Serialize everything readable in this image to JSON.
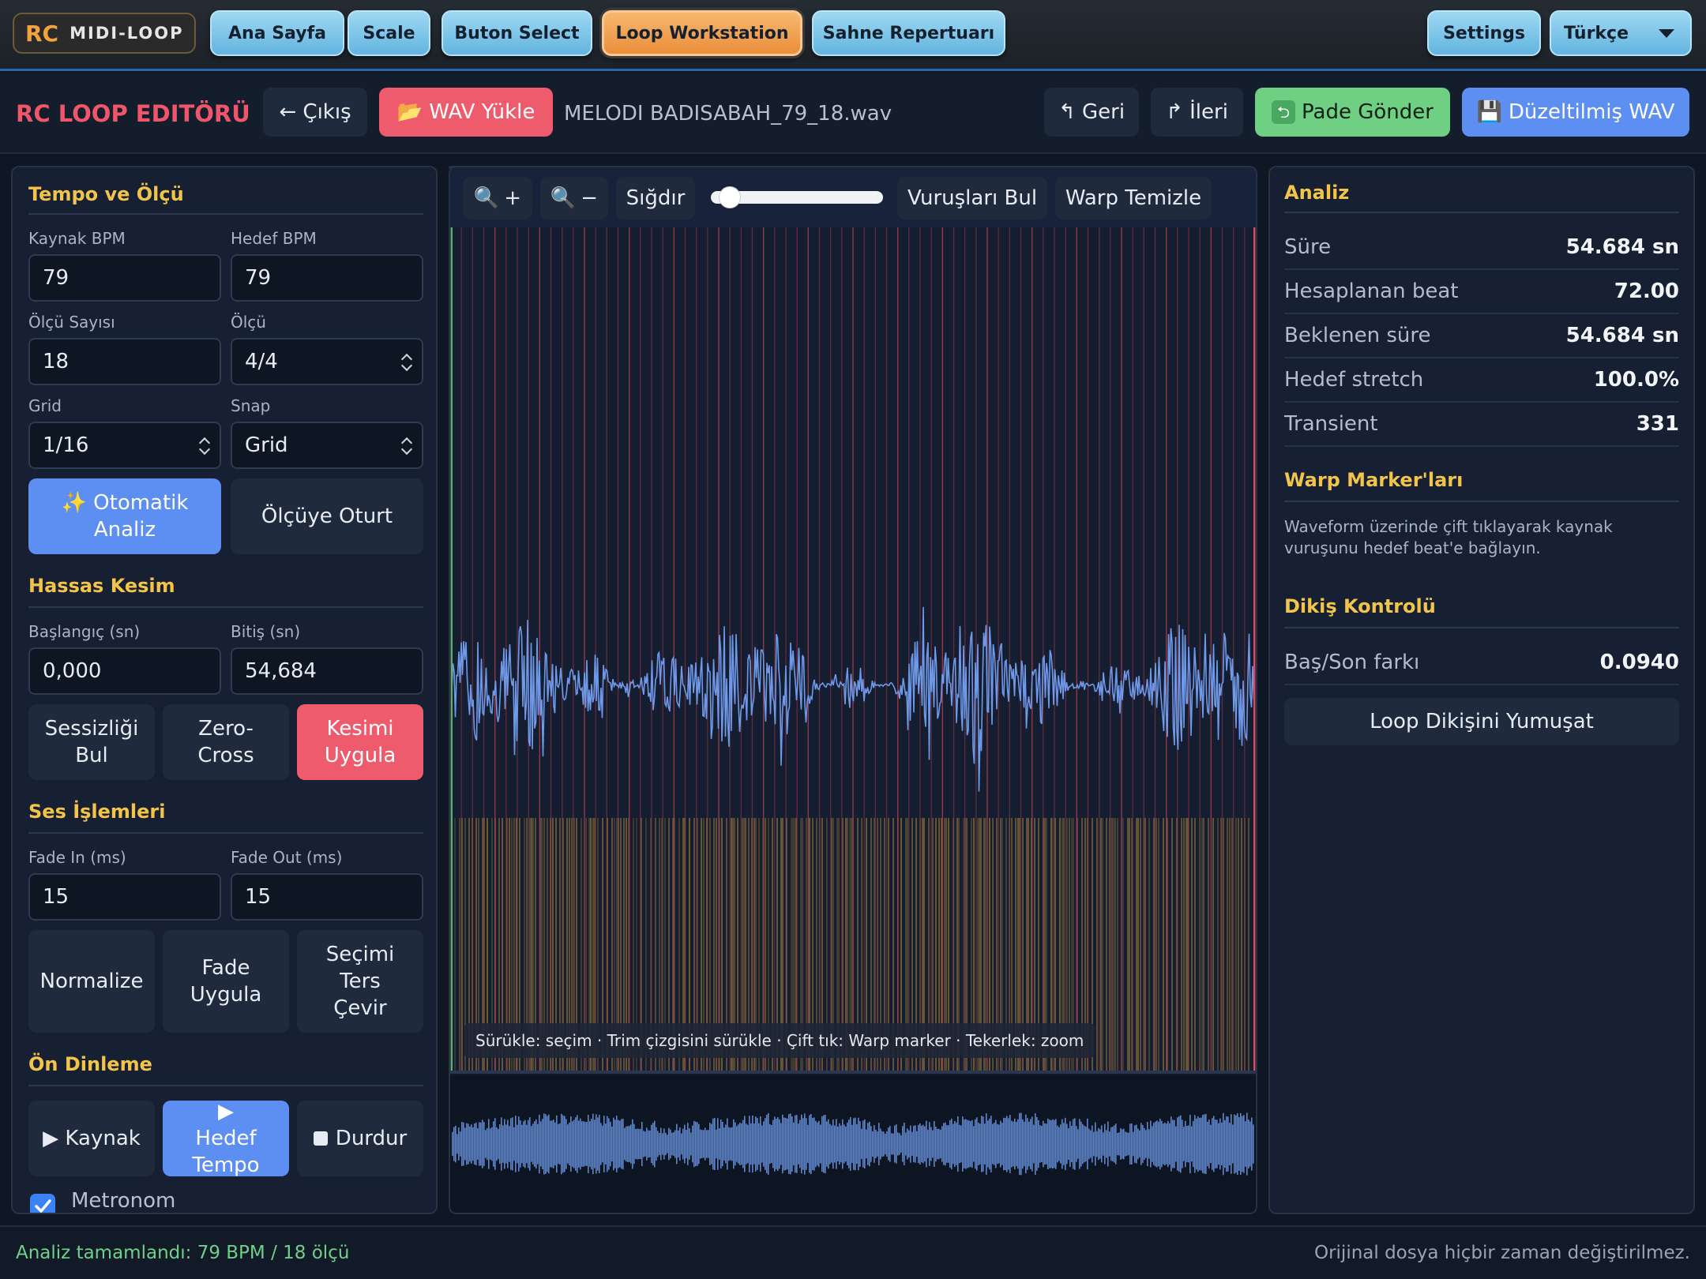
{
  "brand": {
    "logo": "RC",
    "name": "MIDI-LOOP"
  },
  "nav": {
    "items": [
      "Ana Sayfa",
      "Scale",
      "Buton Select",
      "Loop Workstation",
      "Sahne Repertuarı"
    ],
    "active": "Loop Workstation",
    "settings": "Settings",
    "language": "Türkçe"
  },
  "editor": {
    "title": "RC LOOP EDITÖRÜ",
    "exit": "← Çıkış",
    "load_wav": "📂 WAV Yükle",
    "filename": "MELODI BADISABAH_79_18.wav",
    "undo": "↰ Geri",
    "redo": "↱ İleri",
    "send": "Pade Gönder",
    "save": "Düzeltilmiş WAV"
  },
  "left": {
    "tempo_title": "Tempo ve Ölçü",
    "source_bpm_label": "Kaynak BPM",
    "source_bpm": "79",
    "target_bpm_label": "Hedef BPM",
    "target_bpm": "79",
    "bars_label": "Ölçü Sayısı",
    "bars": "18",
    "meter_label": "Ölçü",
    "meter": "4/4",
    "grid_label": "Grid",
    "grid": "1/16",
    "snap_label": "Snap",
    "snap": "Grid",
    "auto_analyze": "✨ Otomatik Analiz",
    "fit_to_bar": "Ölçüye Oturt",
    "cut_title": "Hassas Kesim",
    "start_label": "Başlangıç (sn)",
    "start": "0,000",
    "end_label": "Bitiş (sn)",
    "end": "54,684",
    "find_silence": "Sessizliği Bul",
    "zero_cross": "Zero-Cross",
    "apply_cut": "Kesimi Uygula",
    "audio_title": "Ses İşlemleri",
    "fade_in_label": "Fade In (ms)",
    "fade_in": "15",
    "fade_out_label": "Fade Out (ms)",
    "fade_out": "15",
    "normalize": "Normalize",
    "apply_fade": "Fade Uygula",
    "reverse": "Seçimi Ters Çevir",
    "preview_title": "Ön Dinleme",
    "play_source": "▶ Kaynak",
    "play_target": "▶ Hedef Tempo",
    "stop": "Durdur",
    "metronome": "Metronom",
    "metronome_checked": true
  },
  "waveform": {
    "zoom_in": "+",
    "zoom_out": "−",
    "fit": "Sığdır",
    "zoom_level": 0.05,
    "find_beats": "Vuruşları Bul",
    "clear_warp": "Warp Temizle",
    "hint": "Sürükle: seçim · Trim çizgisini sürükle · Çift tık: Warp marker · Tekerlek: zoom",
    "colors": {
      "wave": "#6f99e8",
      "beat_line": "#b0404e",
      "transient": "#c49a3e"
    }
  },
  "analysis": {
    "title": "Analiz",
    "rows": [
      {
        "label": "Süre",
        "value": "54.684 sn"
      },
      {
        "label": "Hesaplanan beat",
        "value": "72.00"
      },
      {
        "label": "Beklenen süre",
        "value": "54.684 sn"
      },
      {
        "label": "Hedef stretch",
        "value": "100.0%"
      },
      {
        "label": "Transient",
        "value": "331"
      }
    ],
    "warp_title": "Warp Marker'ları",
    "warp_hint": "Waveform üzerinde çift tıklayarak kaynak vuruşunu hedef beat'e bağlayın.",
    "seam_title": "Dikiş Kontrolü",
    "seam_label": "Baş/Son farkı",
    "seam_value": "0.0940",
    "smooth": "Loop Dikişini Yumuşat"
  },
  "status": {
    "left": "Analiz tamamlandı: 79 BPM / 18 ölçü",
    "right": "Orijinal dosya hiçbir zaman değiştirilmez."
  }
}
